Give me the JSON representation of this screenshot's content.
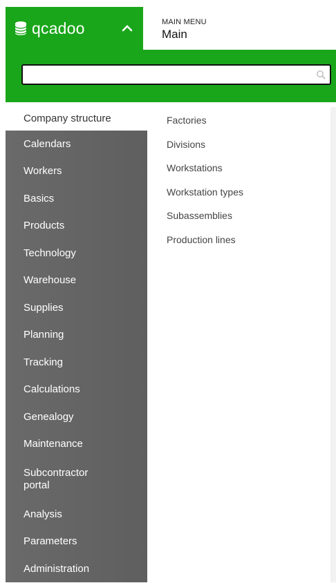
{
  "logo": {
    "text": "qcadoo"
  },
  "header": {
    "small_label": "MAIN MENU",
    "title": "Main"
  },
  "search": {
    "value": "",
    "placeholder": ""
  },
  "sidebar": {
    "items": [
      {
        "label": "Company structure",
        "active": true
      },
      {
        "label": "Calendars"
      },
      {
        "label": "Workers"
      },
      {
        "label": "Basics"
      },
      {
        "label": "Products"
      },
      {
        "label": "Technology"
      },
      {
        "label": "Warehouse"
      },
      {
        "label": "Supplies"
      },
      {
        "label": "Planning"
      },
      {
        "label": "Tracking"
      },
      {
        "label": "Calculations"
      },
      {
        "label": "Genealogy"
      },
      {
        "label": "Maintenance"
      },
      {
        "label": "Subcontractor\nportal"
      },
      {
        "label": "Analysis"
      },
      {
        "label": "Parameters"
      },
      {
        "label": "Administration"
      }
    ]
  },
  "submenu": {
    "items": [
      {
        "label": "Factories"
      },
      {
        "label": "Divisions"
      },
      {
        "label": "Workstations"
      },
      {
        "label": "Workstation types"
      },
      {
        "label": "Subassemblies"
      },
      {
        "label": "Production lines"
      }
    ]
  },
  "colors": {
    "brand": "#1aa61a",
    "sidebar": "#666666"
  }
}
